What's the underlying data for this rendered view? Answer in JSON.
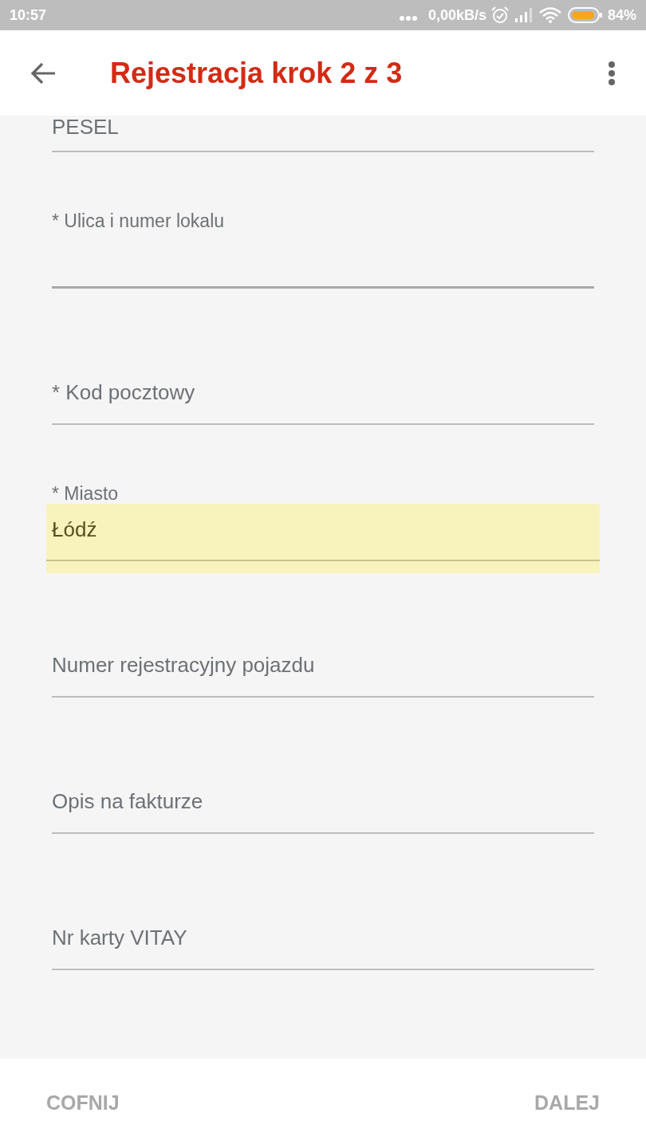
{
  "status_bar": {
    "time": "10:57",
    "network_speed": "0,00kB/s",
    "battery_percent": "84%"
  },
  "app_bar": {
    "title": "Rejestracja krok 2 z 3"
  },
  "fields": [
    {
      "placeholder": "PESEL",
      "focused": false,
      "autofilled": false
    },
    {
      "label": "* Ulica i numer lokalu",
      "focused": true,
      "autofilled": false
    },
    {
      "placeholder": "* Kod pocztowy",
      "focused": false,
      "autofilled": false
    },
    {
      "label": "* Miasto",
      "value": "Łódź",
      "focused": false,
      "autofilled": true
    },
    {
      "placeholder": "Numer rejestracyjny pojazdu",
      "focused": false,
      "autofilled": false
    },
    {
      "placeholder": "Opis na fakturze",
      "focused": false,
      "autofilled": false
    },
    {
      "placeholder": "Nr karty VITAY",
      "focused": false,
      "autofilled": false
    }
  ],
  "buttons": [
    {
      "label": "COFNIJ",
      "disabled": true
    },
    {
      "label": "DALEJ",
      "disabled": true
    }
  ]
}
